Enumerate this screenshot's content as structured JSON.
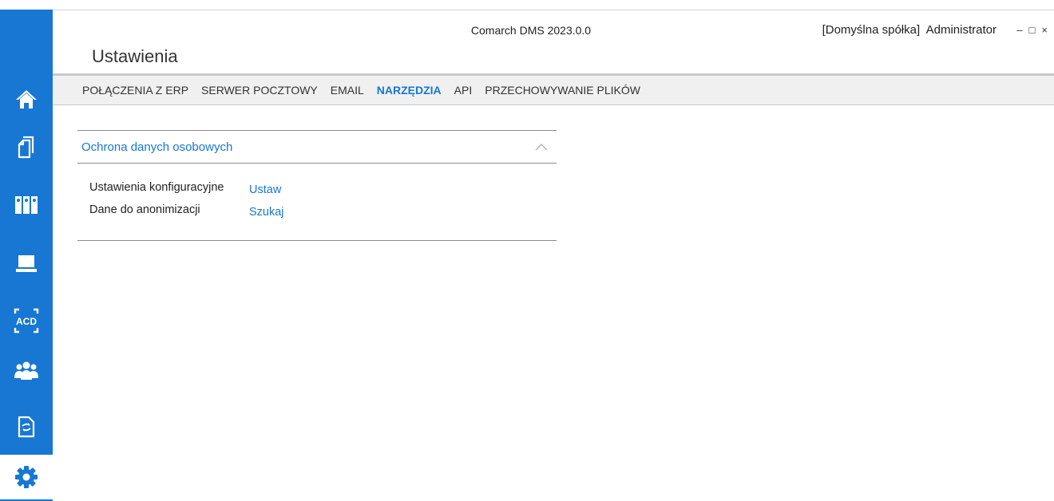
{
  "window": {
    "app_title": "Comarch DMS 2023.0.0",
    "user_info": "[Domyślna spółka]  Administrator",
    "minimize_glyph": "–",
    "maximize_glyph": "□",
    "close_glyph": "×"
  },
  "colors": {
    "accent": "#1877d2",
    "sidebar": "#1877d2",
    "tab_bar": "#f0f0f0"
  },
  "sidebar": {
    "items": [
      {
        "icon": "home-icon"
      },
      {
        "icon": "documents-icon"
      },
      {
        "icon": "binders-icon"
      },
      {
        "icon": "laptop-icon"
      },
      {
        "icon": "acd-scan-icon",
        "text": "ACD"
      },
      {
        "icon": "users-icon"
      },
      {
        "icon": "document-sync-icon"
      },
      {
        "icon": "settings-gear-icon",
        "active": true
      }
    ]
  },
  "page": {
    "title": "Ustawienia"
  },
  "tabs": [
    {
      "label": "POŁĄCZENIA Z ERP"
    },
    {
      "label": "SERWER POCZTOWY"
    },
    {
      "label": "EMAIL"
    },
    {
      "label": "NARZĘDZIA",
      "active": true
    },
    {
      "label": "API"
    },
    {
      "label": "PRZECHOWYWANIE PLIKÓW"
    }
  ],
  "section": {
    "title": "Ochrona danych osobowych",
    "rows": [
      {
        "label": "Ustawienia konfiguracyjne",
        "action": "Ustaw"
      },
      {
        "label": "Dane do anonimizacji",
        "action": "Szukaj"
      }
    ]
  }
}
